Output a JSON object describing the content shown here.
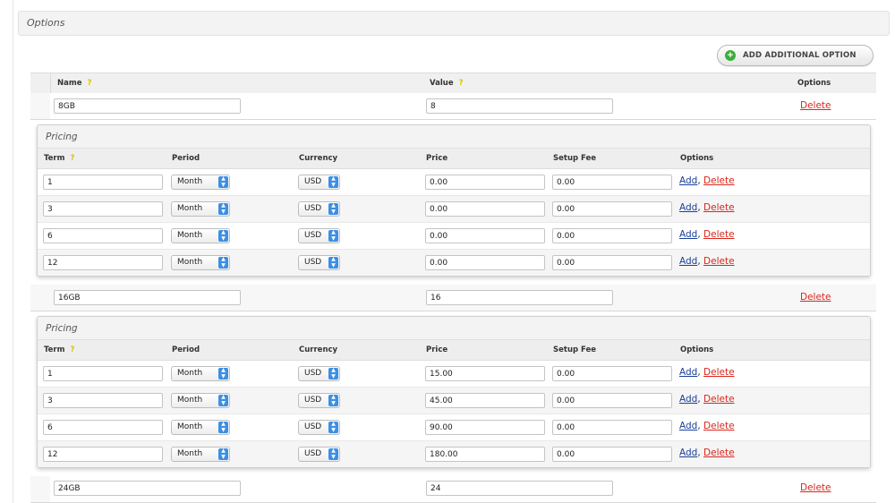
{
  "panel": {
    "title": "Options"
  },
  "add_button": {
    "label": "ADD ADDITIONAL OPTION",
    "icon": "plus-icon"
  },
  "options_table": {
    "headers": {
      "name": "Name",
      "value": "Value",
      "options": "Options",
      "help": "?"
    }
  },
  "pricing_table": {
    "title": "Pricing",
    "headers": {
      "term": "Term",
      "period": "Period",
      "currency": "Currency",
      "price": "Price",
      "setup_fee": "Setup Fee",
      "options": "Options",
      "help": "?"
    },
    "add_label": "Add",
    "comma": ",",
    "delete_label": "Delete"
  },
  "options": [
    {
      "name": "8GB",
      "value": "8",
      "delete_label": "Delete",
      "pricing": [
        {
          "term": "1",
          "period": "Month",
          "currency": "USD",
          "price": "0.00",
          "setup_fee": "0.00"
        },
        {
          "term": "3",
          "period": "Month",
          "currency": "USD",
          "price": "0.00",
          "setup_fee": "0.00"
        },
        {
          "term": "6",
          "period": "Month",
          "currency": "USD",
          "price": "0.00",
          "setup_fee": "0.00"
        },
        {
          "term": "12",
          "period": "Month",
          "currency": "USD",
          "price": "0.00",
          "setup_fee": "0.00"
        }
      ]
    },
    {
      "name": "16GB",
      "value": "16",
      "delete_label": "Delete",
      "pricing": [
        {
          "term": "1",
          "period": "Month",
          "currency": "USD",
          "price": "15.00",
          "setup_fee": "0.00"
        },
        {
          "term": "3",
          "period": "Month",
          "currency": "USD",
          "price": "45.00",
          "setup_fee": "0.00"
        },
        {
          "term": "6",
          "period": "Month",
          "currency": "USD",
          "price": "90.00",
          "setup_fee": "0.00"
        },
        {
          "term": "12",
          "period": "Month",
          "currency": "USD",
          "price": "180.00",
          "setup_fee": "0.00"
        }
      ]
    },
    {
      "name": "24GB",
      "value": "24",
      "delete_label": "Delete",
      "pricing": []
    }
  ]
}
